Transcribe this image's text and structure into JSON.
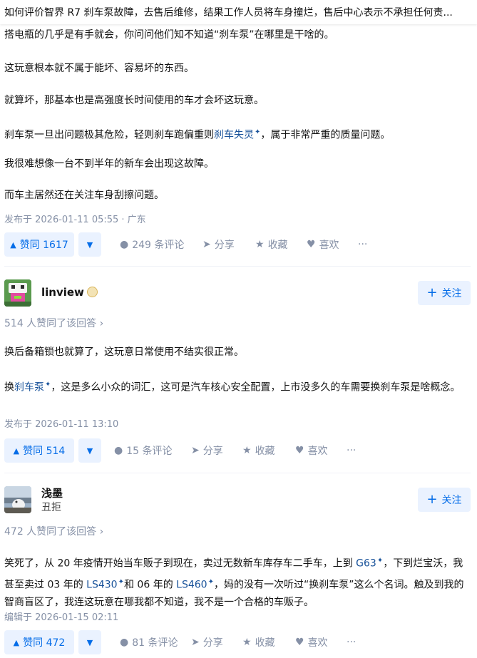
{
  "question_title": "如何评价智界 R7 刹车泵故障，去售后维修，结果工作人员将车身撞烂，售后中心表示不承担任何责...",
  "answers": [
    {
      "paragraphs_first": {
        "p1": "搭电瓶的几乎是有手就会，你问问他们知不知道“刹车泵”在哪里是干啥的。",
        "p2": "这玩意根本就不属于能坏、容易坏的东西。",
        "p3": "就算坏，那基本也是高强度长时间使用的车才会坏这玩意。",
        "p4a": "刹车泵一旦出问题极其危险，轻则刹车跑偏重则",
        "p4link": "刹车失灵",
        "p4b": "，属于非常严重的质量问题。",
        "p5": "我很难想像一台不到半年的新车会出现这故障。",
        "p6": "而车主居然还在关注车身刮擦问题。"
      },
      "meta": "发布于 2026-01-11 05:55 · 广东",
      "vote_label": "赞同 1617",
      "comments": "249 条评论",
      "share": "分享",
      "favorite": "收藏",
      "like": "喜欢"
    },
    {
      "author": "linview",
      "follow": "关注",
      "voters": "514 人赞同了该回答",
      "p1": "换后备箱锁也就算了，这玩意日常使用不结实很正常。",
      "p2a": "换",
      "p2link": "刹车泵",
      "p2b": "，这是多么小众的词汇，这可是汽车核心安全配置，上市没多久的车需要换刹车泵是啥概念。",
      "meta": "发布于 2026-01-11 13:10",
      "vote_label": "赞同 514",
      "comments": "15 条评论",
      "share": "分享",
      "favorite": "收藏",
      "like": "喜欢"
    },
    {
      "author": "浅墨",
      "subtitle": "丑拒",
      "follow": "关注",
      "voters": "472 人赞同了该回答",
      "t1": "笑死了，从 20 年疫情开始当车贩子到现在，卖过无数新车库存车二手车，上到 ",
      "l1": "G63",
      "t2": "，下到烂宝沃，我甚至卖过 03 年的 ",
      "l2": "LS430",
      "t3": "和 06 年的 ",
      "l3": "LS460",
      "t4": "，妈的没有一次听过“换刹车泵”这么个名词。触及到我的智商盲区了，我连这玩意在哪我都不知道，我不是一个合格的车贩子。",
      "meta": "编辑于 2026-01-15 02:11",
      "vote_label": "赞同 472",
      "comments": "81 条评论",
      "share": "分享",
      "favorite": "收藏",
      "like": "喜欢"
    }
  ],
  "colors": {
    "accent": "#056de8",
    "link": "#175199",
    "meta": "#8590a6"
  }
}
